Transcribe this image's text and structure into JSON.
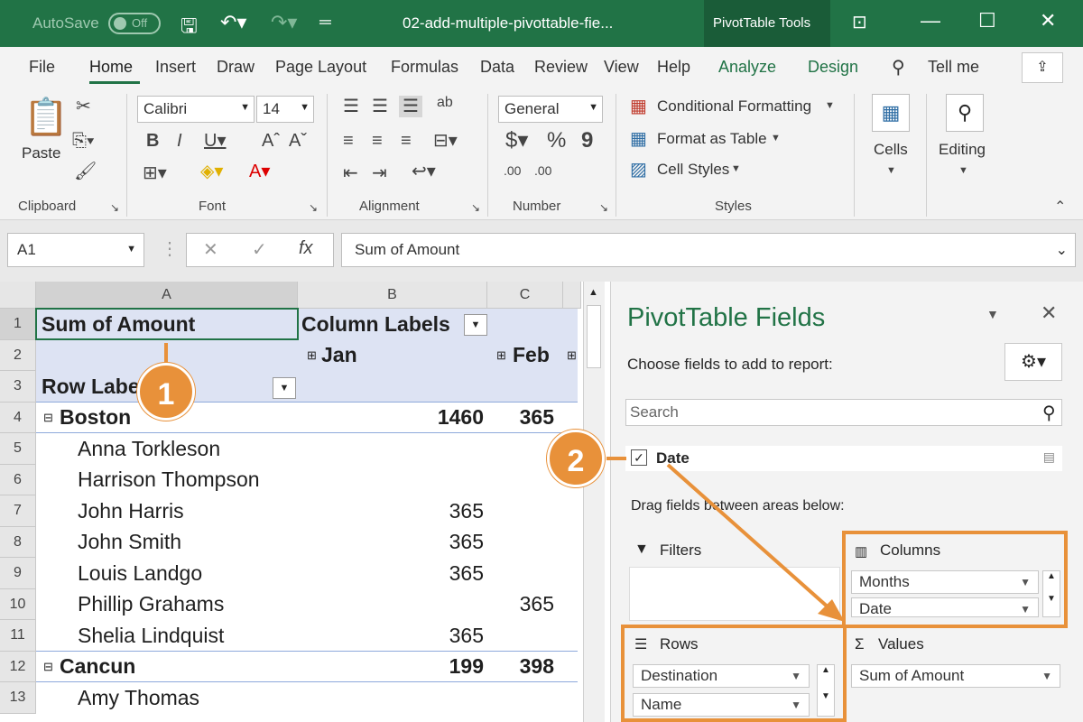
{
  "titlebar": {
    "autosave_label": "AutoSave",
    "autosave_state": "Off",
    "filename": "02-add-multiple-pivottable-fie...",
    "context_tab": "PivotTable Tools"
  },
  "tabs": {
    "file": "File",
    "home": "Home",
    "insert": "Insert",
    "draw": "Draw",
    "page_layout": "Page Layout",
    "formulas": "Formulas",
    "data": "Data",
    "review": "Review",
    "view": "View",
    "help": "Help",
    "analyze": "Analyze",
    "design": "Design",
    "tell_me": "Tell me"
  },
  "ribbon": {
    "paste": "Paste",
    "clipboard": "Clipboard",
    "font_name": "Calibri",
    "font_size": "14",
    "font": "Font",
    "alignment": "Alignment",
    "number_format": "General",
    "number": "Number",
    "cond_format": "Conditional Formatting",
    "format_table": "Format as Table",
    "cell_styles": "Cell Styles",
    "styles": "Styles",
    "cells": "Cells",
    "editing": "Editing"
  },
  "formula_bar": {
    "name_box": "A1",
    "formula": "Sum of Amount"
  },
  "sheet": {
    "columns": [
      "A",
      "B",
      "C"
    ],
    "rows": [
      "1",
      "2",
      "3",
      "4",
      "5",
      "6",
      "7",
      "8",
      "9",
      "10",
      "11",
      "12",
      "13"
    ],
    "r1a": "Sum of Amount",
    "r1b": "Column Labels",
    "r2b": "Jan",
    "r2c": "Feb",
    "r3a": "Row Labe",
    "r4a": "Boston",
    "r4b": "1460",
    "r4c": "365",
    "r5a": "Anna Torkleson",
    "r6a": "Harrison Thompson",
    "r7a": "John Harris",
    "r7b": "365",
    "r8a": "John Smith",
    "r8b": "365",
    "r9a": "Louis Landgo",
    "r9b": "365",
    "r10a": "Phillip Grahams",
    "r10c": "365",
    "r11a": "Shelia Lindquist",
    "r11b": "365",
    "r12a": "Cancun",
    "r12b": "199",
    "r12c": "398",
    "r13a": "Amy Thomas"
  },
  "pane": {
    "title": "PivotTable Fields",
    "subtitle": "Choose fields to add to report:",
    "search_placeholder": "Search",
    "field_date": "Date",
    "drag_hint": "Drag fields between areas below:",
    "filters": "Filters",
    "columns": "Columns",
    "rows": "Rows",
    "values": "Values",
    "col_item1": "Months",
    "col_item2": "Date",
    "row_item1": "Destination",
    "row_item2": "Name",
    "val_item1": "Sum of Amount"
  },
  "callouts": {
    "one": "1",
    "two": "2"
  },
  "colors": {
    "excel_green": "#217346",
    "callout_orange": "#e8913a",
    "pivot_header": "#dde3f3"
  }
}
